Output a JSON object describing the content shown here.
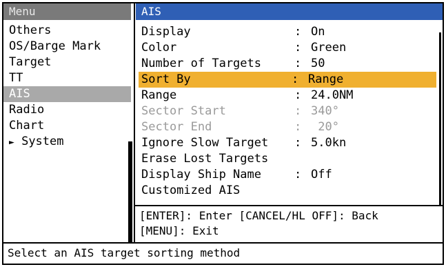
{
  "menu": {
    "title": "Menu",
    "items": [
      {
        "label": "Others"
      },
      {
        "label": "OS/Barge Mark"
      },
      {
        "label": "Target"
      },
      {
        "label": "TT"
      },
      {
        "label": "AIS"
      },
      {
        "label": "Radio"
      },
      {
        "label": "Chart"
      },
      {
        "label": "System",
        "arrow": "►"
      }
    ],
    "selected": "AIS"
  },
  "panel": {
    "title": "AIS",
    "rows": [
      {
        "label": "Display",
        "colon": ":",
        "value": "On"
      },
      {
        "label": "Color",
        "colon": ":",
        "value": "Green"
      },
      {
        "label": "Number of Targets",
        "colon": ":",
        "value": "50"
      },
      {
        "label": "Sort By",
        "colon": ":",
        "value": "Range"
      },
      {
        "label": "Range",
        "colon": ":",
        "value": "24.0NM"
      },
      {
        "label": "Sector Start",
        "colon": ":",
        "value": "340°"
      },
      {
        "label": "Sector End",
        "colon": ":",
        "value": " 20°"
      },
      {
        "label": "Ignore Slow Target",
        "colon": ":",
        "value": "5.0kn"
      },
      {
        "label": "Erase Lost Targets",
        "colon": "",
        "value": ""
      },
      {
        "label": "Display Ship Name",
        "colon": ":",
        "value": "Off"
      },
      {
        "label": "Customized AIS",
        "colon": "",
        "value": ""
      }
    ],
    "highlight_color": "#f0b030",
    "header_color": "#2f5fb5"
  },
  "help": {
    "line1": "[ENTER]: Enter [CANCEL/HL OFF]: Back",
    "line2": "[MENU]: Exit"
  },
  "status": {
    "text": "Select an AIS target sorting method"
  }
}
